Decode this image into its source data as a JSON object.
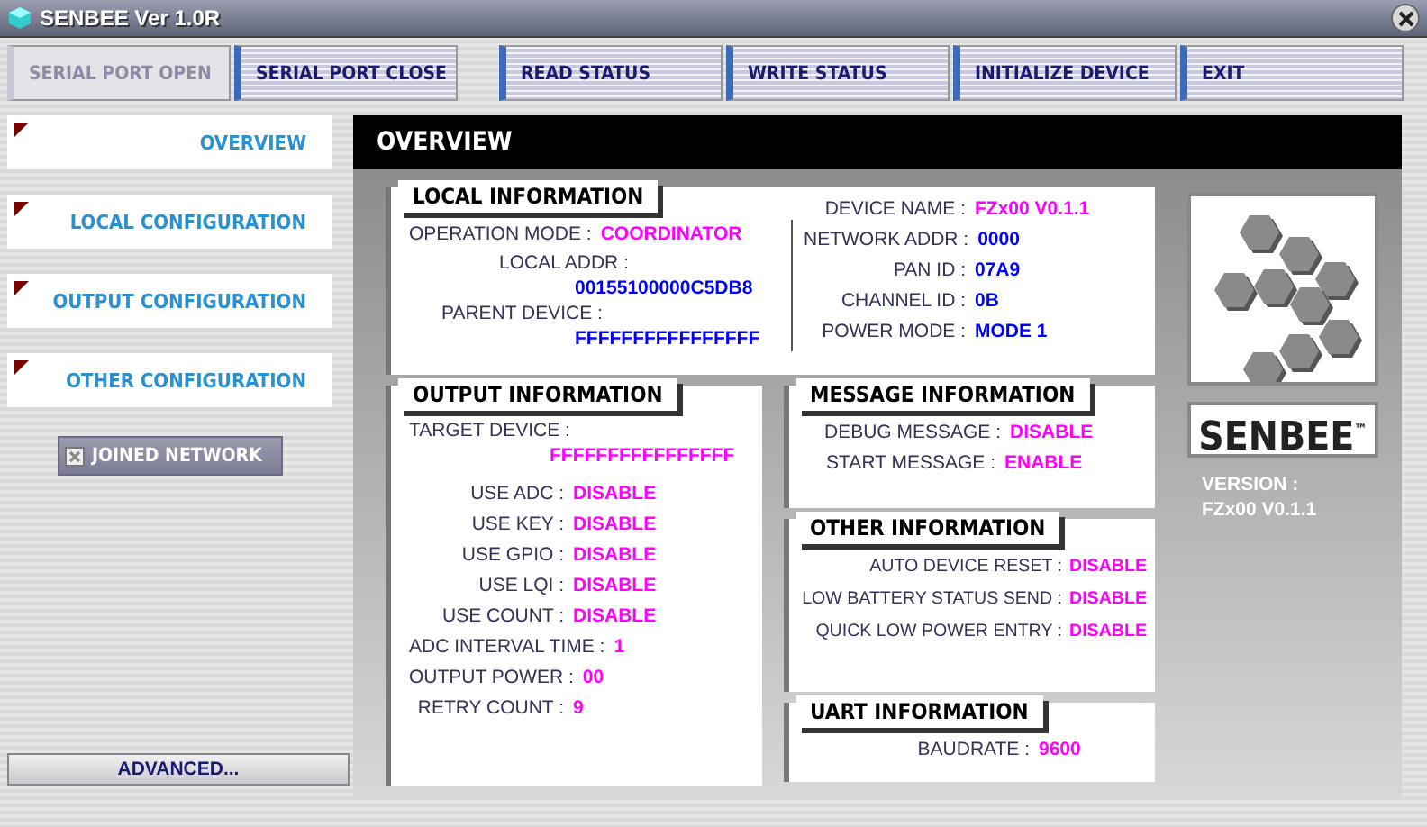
{
  "window": {
    "title": "SENBEE Ver 1.0R"
  },
  "toolbar": [
    {
      "label": "SERIAL PORT OPEN",
      "disabled": true
    },
    {
      "label": "SERIAL PORT CLOSE",
      "disabled": false
    },
    {
      "label": "READ STATUS",
      "disabled": false
    },
    {
      "label": "WRITE STATUS",
      "disabled": false
    },
    {
      "label": "INITIALIZE DEVICE",
      "disabled": false
    },
    {
      "label": "EXIT",
      "disabled": false
    }
  ],
  "sidebar": {
    "items": [
      {
        "label": "OVERVIEW"
      },
      {
        "label": "LOCAL CONFIGURATION"
      },
      {
        "label": "OUTPUT CONFIGURATION"
      },
      {
        "label": "OTHER CONFIGURATION"
      }
    ],
    "joined_network": {
      "label": "JOINED NETWORK",
      "disabled": true
    },
    "advanced_button": "ADVANCED..."
  },
  "overview": {
    "title": "OVERVIEW",
    "local_information": {
      "title": "LOCAL INFORMATION",
      "left_fields": [
        {
          "kind": "inline",
          "label": "OPERATION MODE :",
          "value": "COORDINATOR",
          "color": "#ff00ff"
        },
        {
          "kind": "stacked",
          "label": "LOCAL ADDR :",
          "value": "00155100000C5DB8",
          "color": "#0000ff"
        },
        {
          "kind": "stacked",
          "label": "PARENT DEVICE :",
          "value": "FFFFFFFFFFFFFFFF",
          "color": "#0000ff"
        }
      ],
      "right_fields": [
        {
          "kind": "inline",
          "label": "DEVICE NAME :",
          "value": "FZx00 V0.1.1",
          "color": "#ff00ff"
        },
        {
          "kind": "inline",
          "label": "NETWORK ADDR :",
          "value": "0000",
          "color": "#0000ff"
        },
        {
          "kind": "inline",
          "label": "PAN ID :",
          "value": "07A9",
          "color": "#0000ff"
        },
        {
          "kind": "inline",
          "label": "CHANNEL ID :",
          "value": "0B",
          "color": "#0000ff"
        },
        {
          "kind": "inline",
          "label": "POWER MODE :",
          "value": "MODE 1",
          "color": "#0000ff"
        }
      ]
    },
    "output_information": {
      "title": "OUTPUT INFORMATION",
      "fields": [
        {
          "kind": "stacked",
          "label": "TARGET DEVICE :",
          "value": "FFFFFFFFFFFFFFFF",
          "color": "#ff00ff"
        },
        {
          "kind": "inline",
          "label": "USE ADC :",
          "value": "DISABLE",
          "color": "#ff00ff"
        },
        {
          "kind": "inline",
          "label": "USE KEY :",
          "value": "DISABLE",
          "color": "#ff00ff"
        },
        {
          "kind": "inline",
          "label": "USE GPIO :",
          "value": "DISABLE",
          "color": "#ff00ff"
        },
        {
          "kind": "inline",
          "label": "USE LQI :",
          "value": "DISABLE",
          "color": "#ff00ff"
        },
        {
          "kind": "inline",
          "label": "USE COUNT :",
          "value": "DISABLE",
          "color": "#ff00ff"
        },
        {
          "kind": "inline",
          "label": "ADC INTERVAL TIME :",
          "value": "1",
          "color": "#ff00ff"
        },
        {
          "kind": "inline",
          "label": "OUTPUT POWER :",
          "value": "00",
          "color": "#ff00ff"
        },
        {
          "kind": "inline",
          "label": "RETRY COUNT :",
          "value": "9",
          "color": "#ff00ff"
        }
      ]
    },
    "message_information": {
      "title": "MESSAGE INFORMATION",
      "fields": [
        {
          "kind": "inline",
          "label": "DEBUG MESSAGE :",
          "value": "DISABLE",
          "color": "#ff00ff"
        },
        {
          "kind": "inline",
          "label": "START MESSAGE :",
          "value": "ENABLE",
          "color": "#ff00ff"
        }
      ]
    },
    "other_information": {
      "title": "OTHER INFORMATION",
      "fields": [
        {
          "kind": "inline",
          "label": "AUTO DEVICE RESET :",
          "value": "DISABLE",
          "color": "#ff00ff"
        },
        {
          "kind": "inline",
          "label": "LOW BATTERY STATUS SEND :",
          "value": "DISABLE",
          "color": "#ff00ff"
        },
        {
          "kind": "inline",
          "label": "QUICK LOW POWER ENTRY :",
          "value": "DISABLE",
          "color": "#ff00ff"
        }
      ]
    },
    "uart_information": {
      "title": "UART INFORMATION",
      "fields": [
        {
          "kind": "inline",
          "label": "BAUDRATE :",
          "value": "9600",
          "color": "#ff00ff"
        }
      ]
    }
  },
  "brand": {
    "logo": "SENBEE",
    "trademark": "™",
    "version_label": "VERSION :",
    "version": "FZx00 V0.1.1"
  }
}
